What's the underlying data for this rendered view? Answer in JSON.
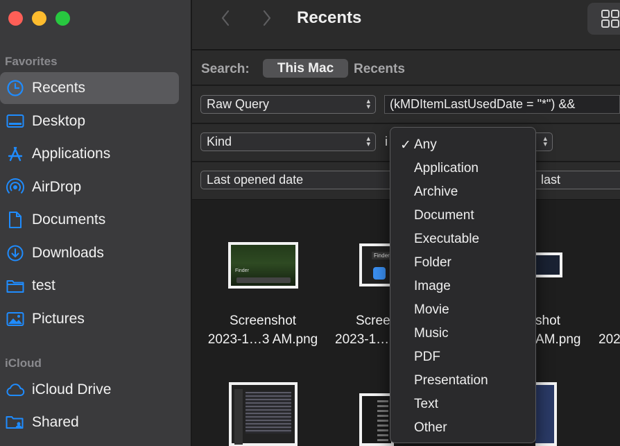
{
  "window": {
    "title": "Recents"
  },
  "sidebar": {
    "favorites_title": "Favorites",
    "icloud_title": "iCloud",
    "favorites": [
      {
        "label": "Recents",
        "icon": "clock-icon",
        "selected": true
      },
      {
        "label": "Desktop",
        "icon": "desktop-icon",
        "selected": false
      },
      {
        "label": "Applications",
        "icon": "applications-icon",
        "selected": false
      },
      {
        "label": "AirDrop",
        "icon": "airdrop-icon",
        "selected": false
      },
      {
        "label": "Documents",
        "icon": "document-icon",
        "selected": false
      },
      {
        "label": "Downloads",
        "icon": "downloads-icon",
        "selected": false
      },
      {
        "label": "test",
        "icon": "folder-icon",
        "selected": false
      },
      {
        "label": "Pictures",
        "icon": "pictures-icon",
        "selected": false
      }
    ],
    "icloud": [
      {
        "label": "iCloud Drive",
        "icon": "cloud-icon"
      },
      {
        "label": "Shared",
        "icon": "shared-folder-icon"
      }
    ]
  },
  "search": {
    "label": "Search:",
    "scopes": [
      "This Mac",
      "Recents"
    ],
    "active_scope": "This Mac"
  },
  "criteria": [
    {
      "attribute": "Raw Query",
      "value": "(kMDItemLastUsedDate = \"*\") &&"
    },
    {
      "attribute": "Kind",
      "operator_fragment": "i"
    },
    {
      "attribute": "Last opened date",
      "trailing_fragment": "last"
    }
  ],
  "files": [
    {
      "name_line1": "Screenshot",
      "name_line2": "2023-1…3 AM.png",
      "thumb_label": "Finder"
    },
    {
      "name_line1": "Scree",
      "name_line2": "2023-1…",
      "thumb_label": "Finder"
    },
    {
      "name_line1": "shot",
      "name_line2": "AM.png"
    },
    {
      "name_line1": "",
      "name_line2": "202"
    }
  ],
  "kind_menu": {
    "selected": "Any",
    "check": "✓",
    "items": [
      "Any",
      "Application",
      "Archive",
      "Document",
      "Executable",
      "Folder",
      "Image",
      "Movie",
      "Music",
      "PDF",
      "Presentation",
      "Text",
      "Other"
    ]
  },
  "colors": {
    "accent": "#1f8cff",
    "sidebar_bg": "#3a3a3c",
    "window_bg": "#1e1e1e"
  }
}
